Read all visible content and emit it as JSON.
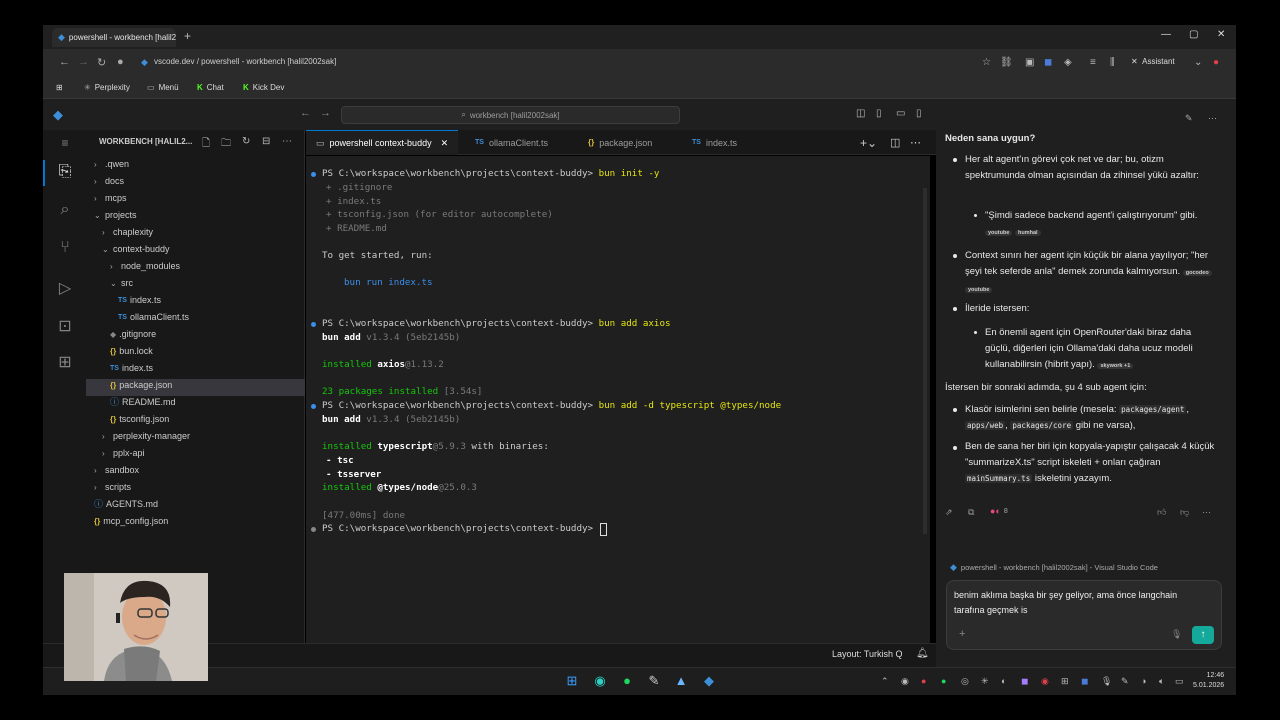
{
  "browser": {
    "tab_title": "powershell - workbench [halil2002sak]",
    "url": "vscode.dev / powershell - workbench [halil2002sak]",
    "assistant_label": "Assistant",
    "bookmarks": [
      "Perplexity",
      "Menü",
      "Chat",
      "Kick Dev"
    ]
  },
  "vscode": {
    "command_center": "workbench [halil2002sak]",
    "explorer_title": "WORKBENCH [HALIL2...",
    "tree": [
      {
        "label": ".qwen",
        "type": "folder",
        "open": false,
        "depth": 0
      },
      {
        "label": "docs",
        "type": "folder",
        "open": false,
        "depth": 0
      },
      {
        "label": "mcps",
        "type": "folder",
        "open": false,
        "depth": 0
      },
      {
        "label": "projects",
        "type": "folder",
        "open": true,
        "depth": 0
      },
      {
        "label": "chaplexity",
        "type": "folder",
        "open": false,
        "depth": 1
      },
      {
        "label": "context-buddy",
        "type": "folder",
        "open": true,
        "depth": 1
      },
      {
        "label": "node_modules",
        "type": "folder",
        "open": false,
        "depth": 2
      },
      {
        "label": "src",
        "type": "folder",
        "open": true,
        "depth": 2
      },
      {
        "label": "index.ts",
        "type": "ts",
        "depth": 3
      },
      {
        "label": "ollamaClient.ts",
        "type": "ts",
        "depth": 3
      },
      {
        "label": ".gitignore",
        "type": "git",
        "depth": 2
      },
      {
        "label": "bun.lock",
        "type": "json",
        "depth": 2
      },
      {
        "label": "index.ts",
        "type": "ts",
        "depth": 2
      },
      {
        "label": "package.json",
        "type": "json",
        "depth": 2
      },
      {
        "label": "README.md",
        "type": "md",
        "depth": 2
      },
      {
        "label": "tsconfig.json",
        "type": "json",
        "depth": 2
      },
      {
        "label": "perplexity-manager",
        "type": "folder",
        "open": false,
        "depth": 1
      },
      {
        "label": "pplx-api",
        "type": "folder",
        "open": false,
        "depth": 1
      },
      {
        "label": "sandbox",
        "type": "folder",
        "open": false,
        "depth": 0
      },
      {
        "label": "scripts",
        "type": "folder",
        "open": false,
        "depth": 0
      },
      {
        "label": "AGENTS.md",
        "type": "md",
        "depth": 0
      },
      {
        "label": "mcp_config.json",
        "type": "json",
        "depth": 0
      }
    ],
    "tabs": [
      {
        "label": "powershell context-buddy",
        "icon": "terminal-icon",
        "active": true
      },
      {
        "label": "ollamaClient.ts",
        "icon": "TS",
        "active": false
      },
      {
        "label": "package.json",
        "icon": "{}",
        "active": false
      },
      {
        "label": "index.ts",
        "icon": "TS",
        "active": false
      }
    ],
    "terminal": {
      "prompt": "PS C:\\workspace\\workbench\\projects\\context-buddy>",
      "cmd1": "bun init -y",
      "init_files": [
        "+ .gitignore",
        "+ index.ts",
        "+ tsconfig.json (for editor autocomplete)",
        "+ README.md"
      ],
      "get_started": "To get started, run:",
      "run_cmd": "bun run index.ts",
      "cmd2": "bun add axios",
      "bun_add": "bun add",
      "bun_version": "v1.3.4 (5eb2145b)",
      "installed": "installed",
      "axios": "axios",
      "axios_ver": "@1.13.2",
      "pkg_count": "23 packages installed",
      "pkg_time": "[3.54s]",
      "cmd3": "bun add -d typescript @types/node",
      "typescript": "typescript",
      "ts_ver": "@5.9.3",
      "with_binaries": "with binaries:",
      "bin1": "- tsc",
      "bin2": "- tsserver",
      "types_node": "@types/node",
      "types_ver": "@25.0.3",
      "done_time": "[477.00ms]",
      "done": "done"
    },
    "status_layout": "Layout: Turkish Q"
  },
  "assistant": {
    "heading": "Neden sana uygun?",
    "p1": "Her alt agent'ın görevi çok net ve dar; bu, otizm spektrumunda olman açısından da zihinsel yükü azaltır:",
    "p1_sub": "\"Şimdi sadece backend agent'i çalıştırıyorum\" gibi.",
    "p1_chips": [
      "youtube",
      "humhal"
    ],
    "p2": "Context sınırı her agent için küçük bir alana yayılıyor; \"her şeyi tek seferde anla\" demek zorunda kalmıyorsun.",
    "p2_chips": [
      "gocodeo",
      "youtube"
    ],
    "p3": "İleride istersen:",
    "p3_sub": "En önemli agent için OpenRouter'daki biraz daha güçlü, diğerleri için Ollama'daki daha ucuz modeli kullanabilirsin (hibrit yapı).",
    "p3_chip": "skywork +1",
    "p4": "İstersen bir sonraki adımda, şu 4 sub agent için:",
    "b1_pre": "Klasör isimlerini sen belirle (mesela:",
    "b1_codes": [
      "packages/agent",
      "apps/web",
      "packages/core"
    ],
    "b1_post": "gibi ne varsa),",
    "b2_pre": "Ben de sana her biri için kopyala-yapıştır çalışacak 4 küçük \"summarizeX.ts\" script iskeleti + onları çağıran",
    "b2_code": "mainSummary.ts",
    "b2_post": "iskeletini yazayım.",
    "source_count": "8",
    "context_label": "powershell - workbench [halil2002sak] - Visual Studio Code",
    "input_text": "benim aklıma başka bir şey geliyor, ama önce langchain tarafına geçmek is"
  },
  "taskbar": {
    "time": "12:46",
    "date": "5.01.2026"
  }
}
